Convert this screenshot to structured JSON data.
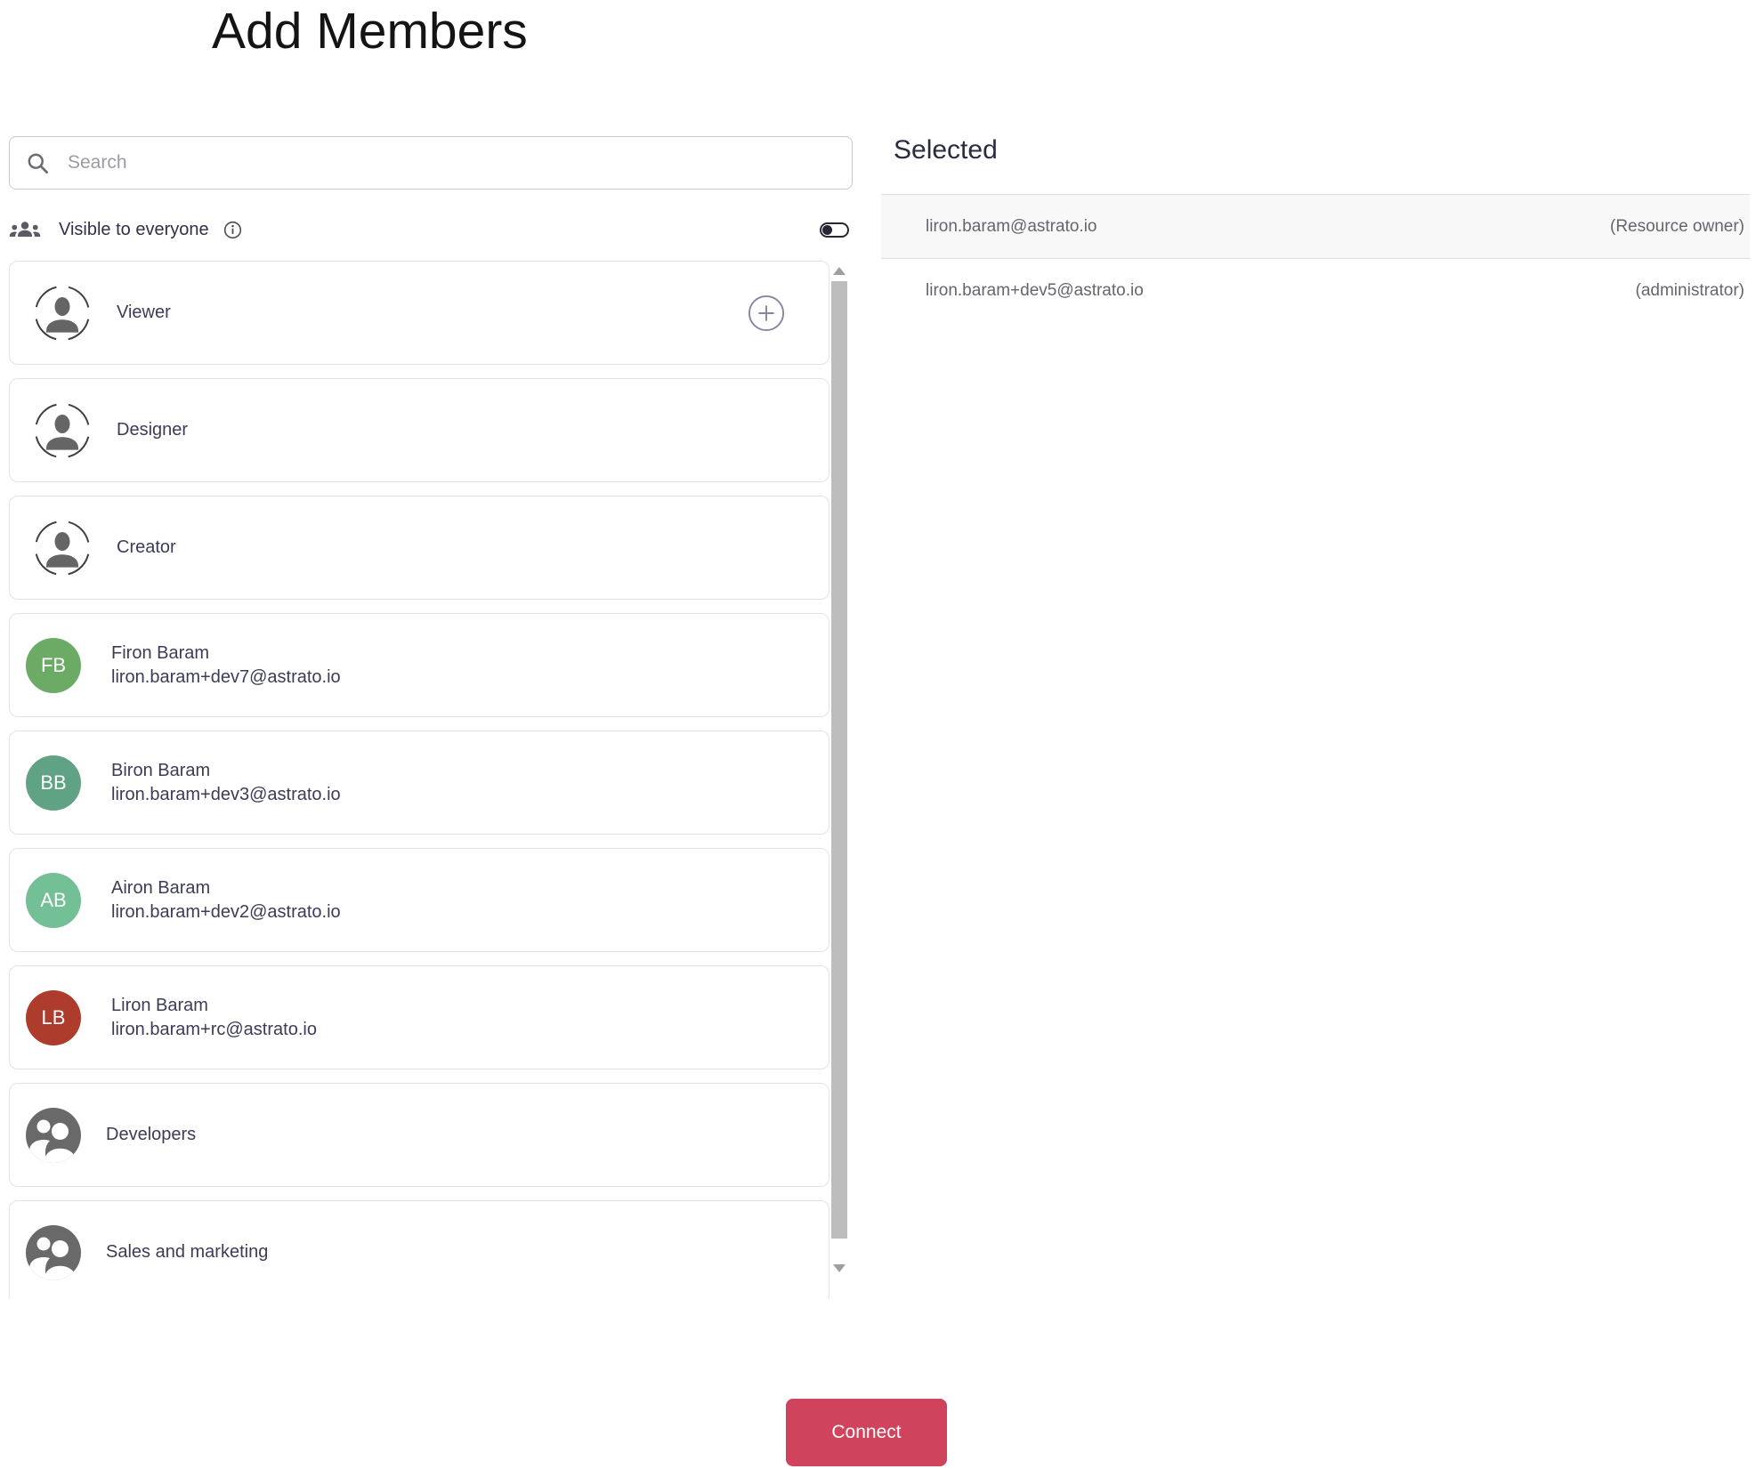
{
  "page": {
    "title": "Add Members"
  },
  "search": {
    "placeholder": "Search"
  },
  "visibility": {
    "label": "Visible to everyone",
    "toggle_state": "off"
  },
  "member_list": {
    "items": [
      {
        "type": "role",
        "name": "Viewer",
        "has_add_button": true
      },
      {
        "type": "role",
        "name": "Designer"
      },
      {
        "type": "role",
        "name": "Creator"
      },
      {
        "type": "user",
        "initials": "FB",
        "name": "Firon Baram",
        "email": "liron.baram+dev7@astrato.io",
        "avatar_color": "#6bab66"
      },
      {
        "type": "user",
        "initials": "BB",
        "name": "Biron Baram",
        "email": "liron.baram+dev3@astrato.io",
        "avatar_color": "#5fa284"
      },
      {
        "type": "user",
        "initials": "AB",
        "name": "Airon Baram",
        "email": "liron.baram+dev2@astrato.io",
        "avatar_color": "#73bf96"
      },
      {
        "type": "user",
        "initials": "LB",
        "name": "Liron Baram",
        "email": "liron.baram+rc@astrato.io",
        "avatar_color": "#ad3c2c"
      },
      {
        "type": "group",
        "name": "Developers"
      },
      {
        "type": "group",
        "name": "Sales and marketing"
      }
    ]
  },
  "selected_panel": {
    "heading": "Selected",
    "members": [
      {
        "email": "liron.baram@astrato.io",
        "role": "(Resource owner)"
      },
      {
        "email": "liron.baram+dev5@astrato.io",
        "role": "(administrator)"
      }
    ]
  },
  "actions": {
    "connect_label": "Connect"
  },
  "colors": {
    "accent_button": "#d0435c",
    "group_avatar": "#696969"
  }
}
